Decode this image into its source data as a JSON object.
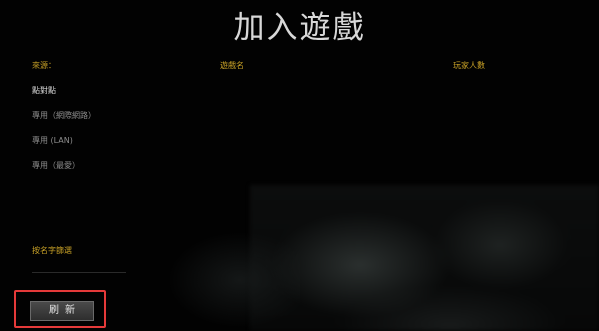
{
  "title": "加入遊戲",
  "headers": {
    "source": "來源：",
    "game_name": "遊戲名",
    "player_count": "玩家人數"
  },
  "sources": [
    {
      "label": "點對點",
      "selected": true
    },
    {
      "label": "專用（網際網路）",
      "selected": false
    },
    {
      "label": "專用 (LAN)",
      "selected": false
    },
    {
      "label": "專用（最愛）",
      "selected": false
    }
  ],
  "filter": {
    "label": "按名字篩選",
    "value": ""
  },
  "refresh_label": "刷新",
  "colors": {
    "accent": "#c9a227",
    "highlight": "#e53a3a"
  }
}
